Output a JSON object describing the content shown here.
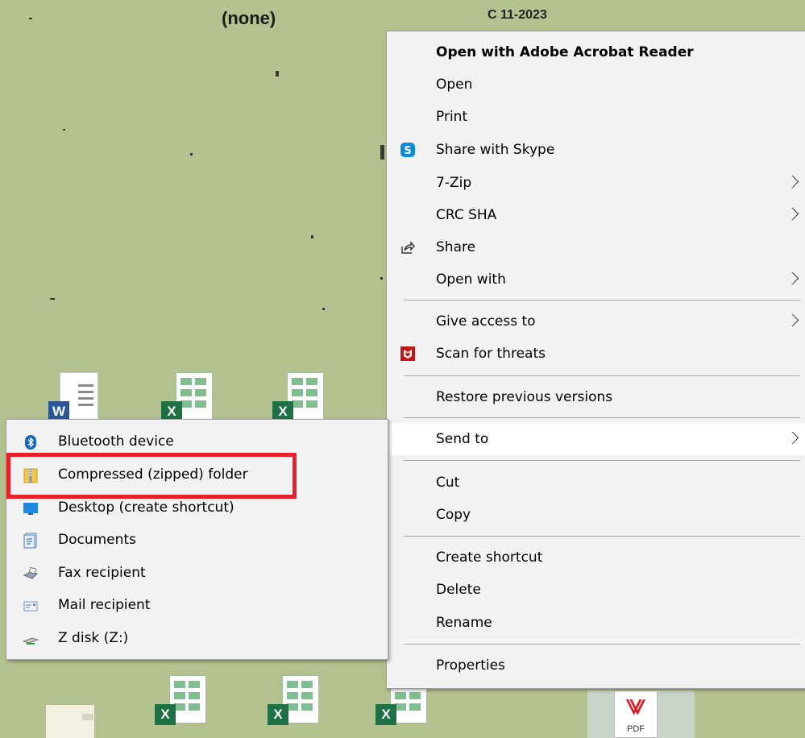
{
  "desktop": {
    "wallpaper_title": "(none)",
    "wallpaper_code": "C 11-2023"
  },
  "context_menu": {
    "items": [
      {
        "label": "Open with Adobe Acrobat Reader"
      },
      {
        "label": "Open"
      },
      {
        "label": "Print"
      },
      {
        "label": "Share with Skype",
        "icon": "skype-icon"
      },
      {
        "label": "7-Zip"
      },
      {
        "label": "CRC SHA"
      },
      {
        "label": "Share",
        "icon": "share-icon"
      },
      {
        "label": "Open with"
      },
      {
        "label": "Give access to"
      },
      {
        "label": "Scan for threats",
        "icon": "mcafee-shield-icon"
      },
      {
        "label": "Restore previous versions"
      },
      {
        "label": "Send to"
      },
      {
        "label": "Cut"
      },
      {
        "label": "Copy"
      },
      {
        "label": "Create shortcut"
      },
      {
        "label": "Delete"
      },
      {
        "label": "Rename"
      },
      {
        "label": "Properties"
      }
    ]
  },
  "send_to_menu": {
    "items": [
      {
        "label": "Bluetooth device",
        "icon": "bluetooth-icon"
      },
      {
        "label": "Compressed (zipped) folder",
        "icon": "zip-folder-icon"
      },
      {
        "label": "Desktop (create shortcut)",
        "icon": "desktop-icon"
      },
      {
        "label": "Documents",
        "icon": "documents-icon"
      },
      {
        "label": "Fax recipient",
        "icon": "fax-icon"
      },
      {
        "label": "Mail recipient",
        "icon": "mail-icon"
      },
      {
        "label": "Z disk (Z:)",
        "icon": "network-drive-icon"
      }
    ]
  },
  "desktop_icons": {
    "word_badge": "W",
    "excel_badge": "X",
    "pdf_label": "PDF"
  },
  "colors": {
    "wallpaper": "#b3c28e",
    "menu_background": "#f2f2f2",
    "menu_highlight": "#ffffff",
    "annotation_red": "#e8202a",
    "skype_blue": "#0b8bd9",
    "mcafee_red": "#c01818",
    "word_blue": "#2b5797",
    "excel_green": "#1e7145"
  }
}
